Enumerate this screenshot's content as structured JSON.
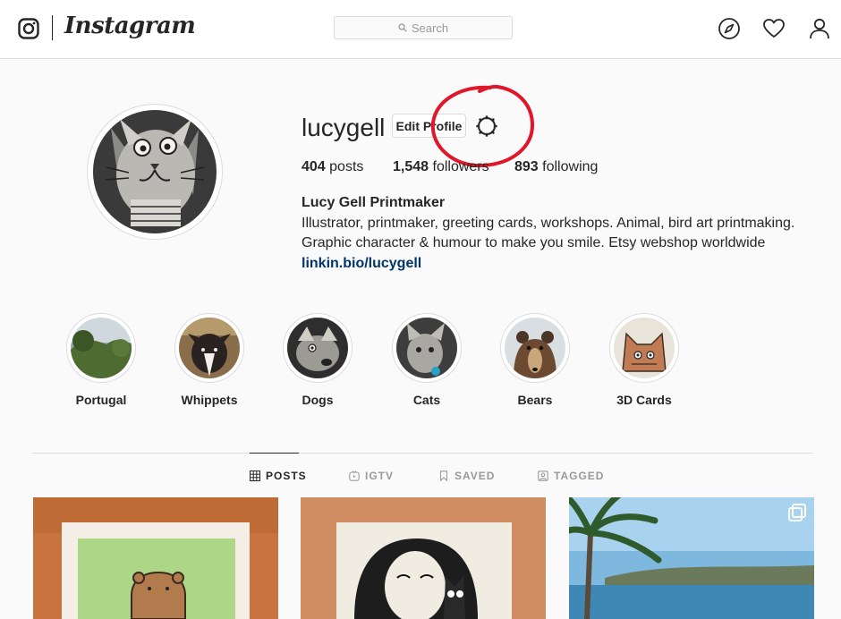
{
  "brand": {
    "wordmark": "Instagram"
  },
  "search": {
    "placeholder": "Search"
  },
  "nav": {
    "icons": [
      "explore-compass-icon",
      "activity-heart-icon",
      "profile-person-icon"
    ]
  },
  "profile": {
    "username": "lucygell",
    "edit_button": "Edit Profile",
    "stats": {
      "posts_count": "404",
      "posts_label": "posts",
      "followers_count": "1,548",
      "followers_label": "followers",
      "following_count": "893",
      "following_label": "following"
    },
    "bio": {
      "name": "Lucy Gell Printmaker",
      "line1": "Illustrator, printmaker, greeting cards, workshops. Animal, bird art printmaking.",
      "line2": "Graphic character & humour to make you smile. Etsy webshop worldwide",
      "link": "linkin.bio/lucygell"
    }
  },
  "highlights": [
    {
      "label": "Portugal"
    },
    {
      "label": "Whippets"
    },
    {
      "label": "Dogs"
    },
    {
      "label": "Cats"
    },
    {
      "label": "Bears"
    },
    {
      "label": "3D Cards"
    }
  ],
  "tabs": [
    {
      "label": "POSTS",
      "active": true
    },
    {
      "label": "IGTV",
      "active": false
    },
    {
      "label": "SAVED",
      "active": false
    },
    {
      "label": "TAGGED",
      "active": false
    }
  ],
  "colors": {
    "link": "#003569",
    "border": "#dbdbdb",
    "annotation": "#e0162b"
  }
}
